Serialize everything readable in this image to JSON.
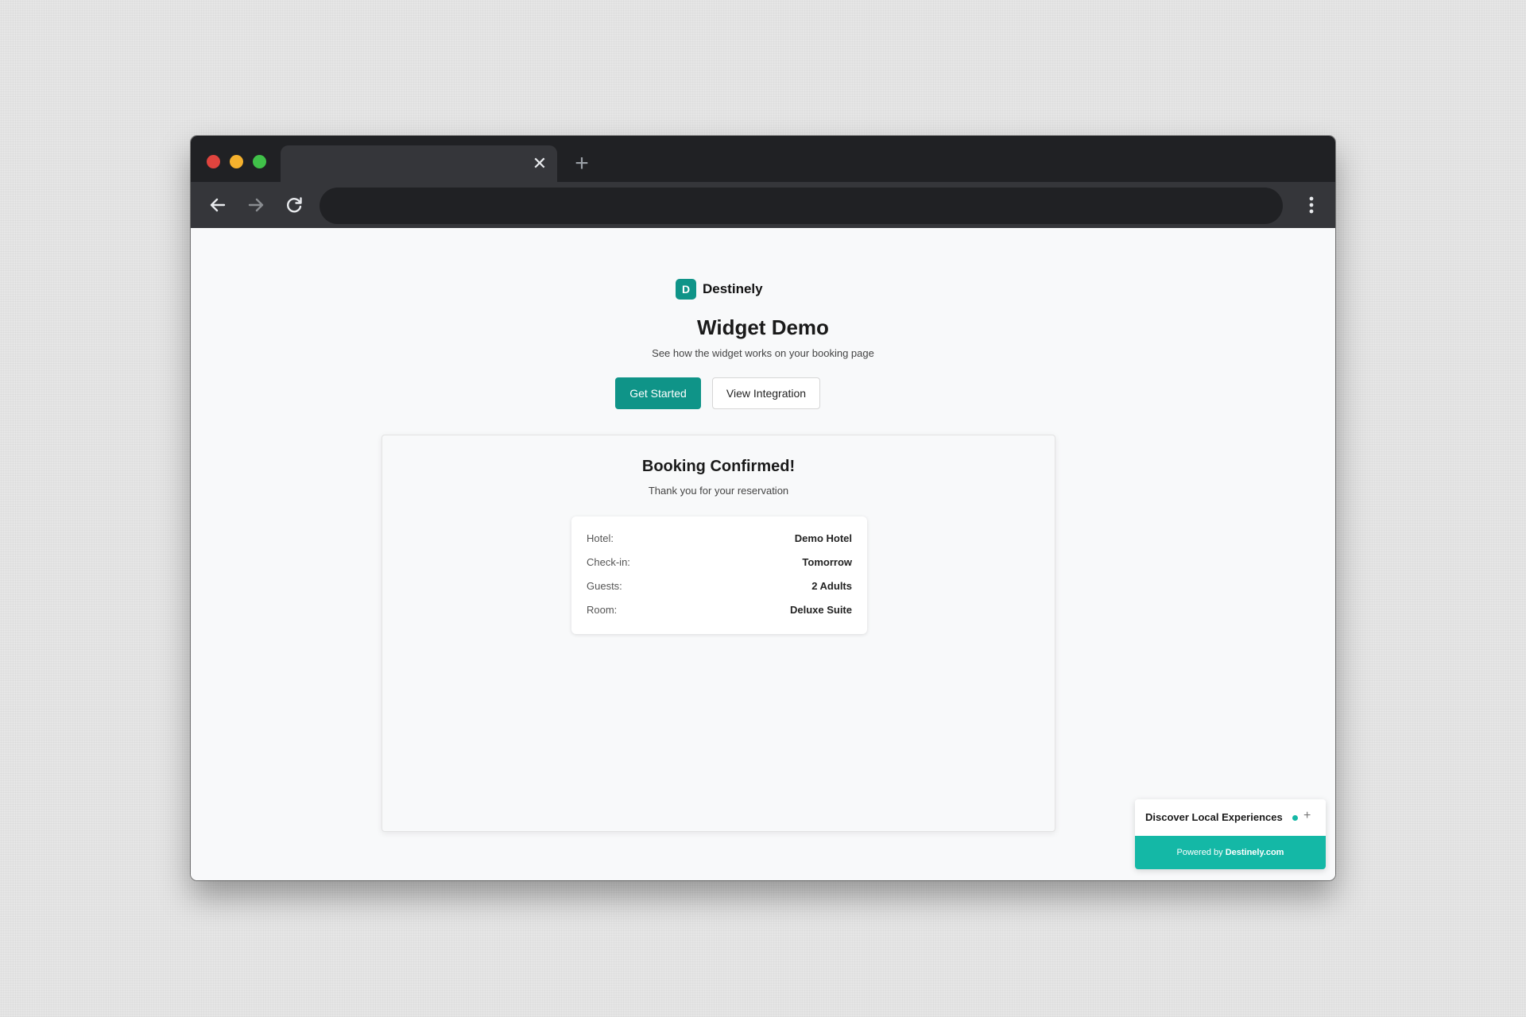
{
  "browser": {
    "tab_close_glyph": "✕",
    "new_tab_glyph": "+",
    "icons": [
      "back-icon",
      "forward-icon",
      "reload-icon",
      "kebab-menu-icon"
    ],
    "traffic_light_colors": [
      "#e0443e",
      "#f5b12d",
      "#40c149"
    ]
  },
  "page": {
    "brand_logo_letter": "D",
    "brand_name": "Destinely",
    "title": "Widget Demo",
    "subtitle": "See how the widget works on your booking page",
    "primary_button": "Get Started",
    "secondary_button": "View Integration",
    "accent_color": "#0f9488"
  },
  "booking": {
    "title": "Booking Confirmed!",
    "subtitle": "Thank you for your reservation",
    "details": [
      {
        "label": "Hotel:",
        "value": "Demo Hotel"
      },
      {
        "label": "Check-in:",
        "value": "Tomorrow"
      },
      {
        "label": "Guests:",
        "value": "2 Adults"
      },
      {
        "label": "Room:",
        "value": "Deluxe Suite"
      }
    ]
  },
  "widget": {
    "title": "Discover Local Experiences",
    "expand_glyph": "+",
    "powered_by_prefix": "Powered by",
    "powered_by_brand": "Destinely.com",
    "color": "#14b8a6"
  }
}
